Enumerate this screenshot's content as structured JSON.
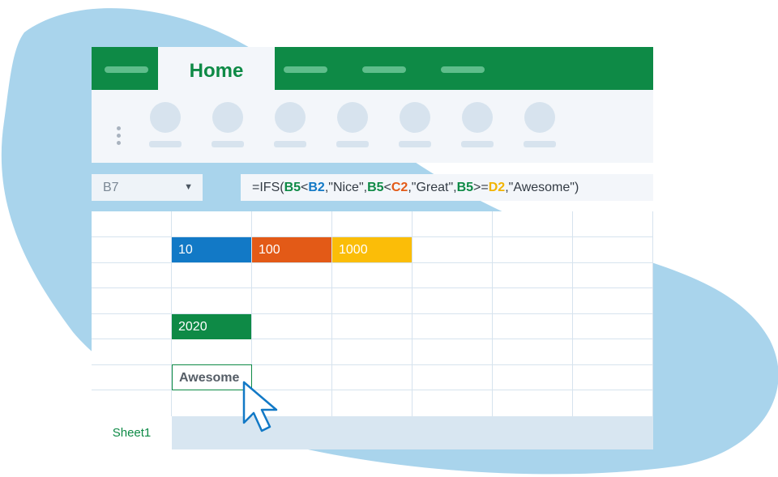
{
  "ribbon": {
    "active_tab": "Home"
  },
  "formula_bar": {
    "cell_reference": "B7",
    "formula_tokens": [
      {
        "text": "=IFS(",
        "color": "#333b44"
      },
      {
        "text": "B5",
        "color": "#0e8a46"
      },
      {
        "text": "<",
        "color": "#333b44"
      },
      {
        "text": "B2",
        "color": "#1279c6"
      },
      {
        "text": ",\"Nice\",",
        "color": "#333b44"
      },
      {
        "text": "B5",
        "color": "#0e8a46"
      },
      {
        "text": "<",
        "color": "#333b44"
      },
      {
        "text": "C2",
        "color": "#e35a17"
      },
      {
        "text": ",\"Great\",",
        "color": "#333b44"
      },
      {
        "text": "B5",
        "color": "#0e8a46"
      },
      {
        "text": ">=",
        "color": "#333b44"
      },
      {
        "text": "D2",
        "color": "#f2b400"
      },
      {
        "text": ",\"Awesome\")",
        "color": "#333b44"
      }
    ]
  },
  "cells": {
    "B2": "10",
    "C2": "100",
    "D2": "1000",
    "B5": "2020",
    "B7": "Awesome"
  },
  "sheets": {
    "active": "Sheet1"
  },
  "colors": {
    "brand_green": "#0e8a46",
    "blue": "#1279c6",
    "orange": "#e35a17",
    "yellow": "#fbbd08",
    "blob": "#a9d4ec"
  }
}
